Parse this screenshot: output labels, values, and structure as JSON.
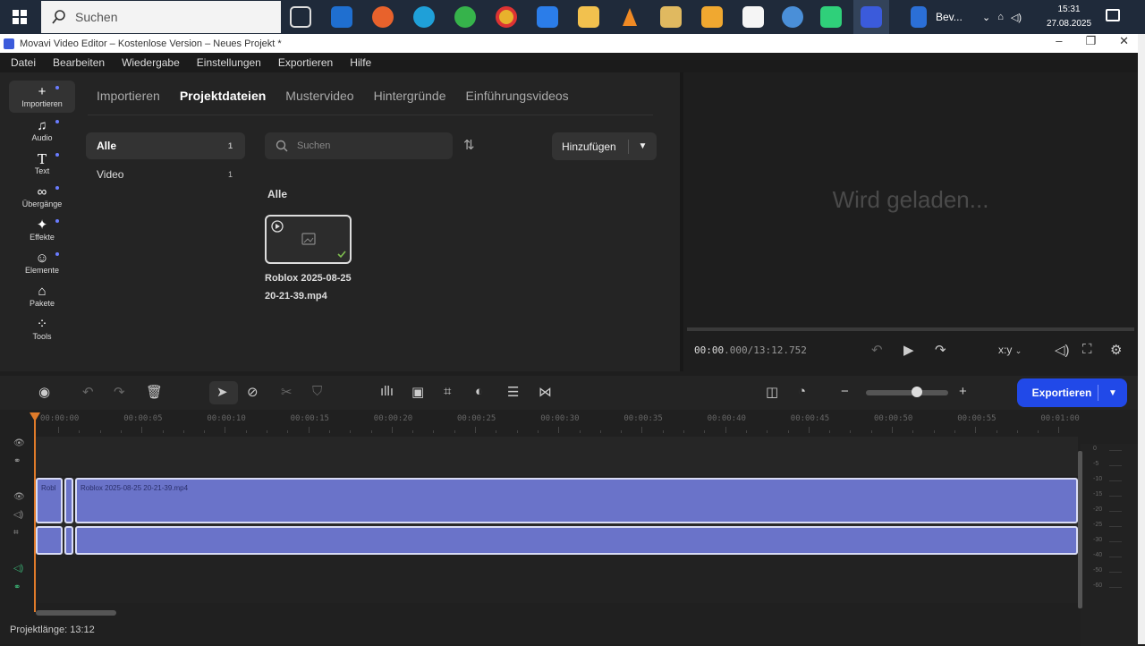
{
  "taskbar": {
    "search_placeholder": "Suchen",
    "notification_label": "Bev...",
    "clock_time": "15:31",
    "clock_date": "27.08.2025"
  },
  "window": {
    "title": "Movavi Video Editor – Kostenlose Version – Neues Projekt *"
  },
  "menu": {
    "items": [
      "Datei",
      "Bearbeiten",
      "Wiedergabe",
      "Einstellungen",
      "Exportieren",
      "Hilfe"
    ]
  },
  "sidebar": {
    "items": [
      {
        "label": "Importieren",
        "icon": "plus-icon"
      },
      {
        "label": "Audio",
        "icon": "music-note-icon"
      },
      {
        "label": "Text",
        "icon": "text-icon"
      },
      {
        "label": "Übergänge",
        "icon": "transition-icon"
      },
      {
        "label": "Effekte",
        "icon": "sparkle-icon"
      },
      {
        "label": "Elemente",
        "icon": "smiley-icon"
      },
      {
        "label": "Pakete",
        "icon": "package-icon"
      },
      {
        "label": "Tools",
        "icon": "tools-icon"
      }
    ]
  },
  "import_panel": {
    "tabs": [
      "Importieren",
      "Projektdateien",
      "Mustervideo",
      "Hintergründe",
      "Einführungsvideos"
    ],
    "active_tab": "Projektdateien",
    "categories": [
      {
        "label": "Alle",
        "count": "1"
      },
      {
        "label": "Video",
        "count": "1"
      }
    ],
    "search_placeholder": "Suchen",
    "add_button": "Hinzufügen",
    "section_title": "Alle",
    "files": [
      {
        "name": "Roblox 2025-08-25 20-21-39.mp4"
      }
    ]
  },
  "preview": {
    "loading_text": "Wird geladen...",
    "time_current": "00:00",
    "time_current_ms": ".000",
    "time_total": "/13:12.752",
    "aspect_label": "x:y"
  },
  "toolbar": {
    "export_label": "Exportieren"
  },
  "timeline": {
    "ruler_labels": [
      "00:00:00",
      "00:00:05",
      "00:00:10",
      "00:00:15",
      "00:00:20",
      "00:00:25",
      "00:00:30",
      "00:00:35",
      "00:00:40",
      "00:00:45",
      "00:00:50",
      "00:00:55",
      "00:01:00"
    ],
    "clip_short_title": "Robl",
    "clip_title": "Roblox 2025-08-25 20-21-39.mp4",
    "meter_marks": [
      "0",
      "-5",
      "-10",
      "-15",
      "-20",
      "-25",
      "-30",
      "-40",
      "-50",
      "-60"
    ],
    "project_length": "Projektlänge: 13:12"
  }
}
